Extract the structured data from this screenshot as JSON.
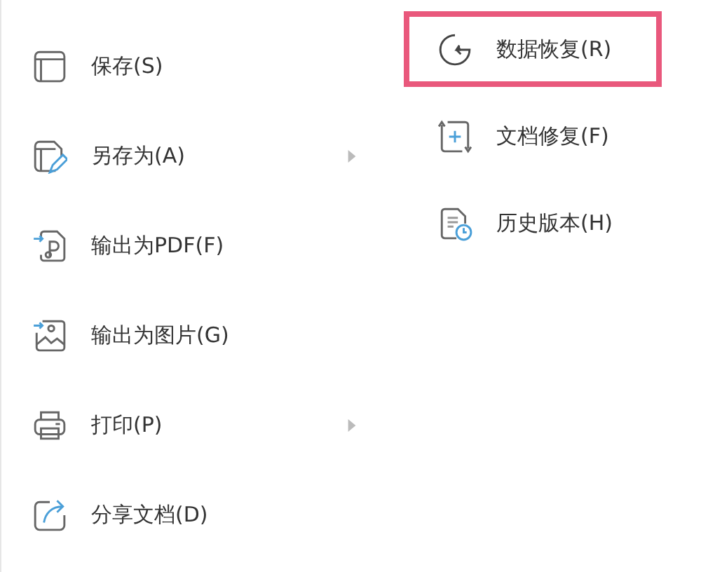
{
  "menu": [
    {
      "label": "保存(S)",
      "kind": "save",
      "has_submenu": false
    },
    {
      "label": "另存为(A)",
      "kind": "save-as",
      "has_submenu": true
    },
    {
      "label": "输出为PDF(F)",
      "kind": "pdf",
      "has_submenu": false
    },
    {
      "label": "输出为图片(G)",
      "kind": "image",
      "has_submenu": false
    },
    {
      "label": "打印(P)",
      "kind": "print",
      "has_submenu": true
    },
    {
      "label": "分享文档(D)",
      "kind": "share",
      "has_submenu": false
    }
  ],
  "submenu": [
    {
      "label": "数据恢复(R)",
      "kind": "restore",
      "highlighted": true
    },
    {
      "label": "文档修复(F)",
      "kind": "repair",
      "highlighted": false
    },
    {
      "label": "历史版本(H)",
      "kind": "history",
      "highlighted": false
    }
  ]
}
